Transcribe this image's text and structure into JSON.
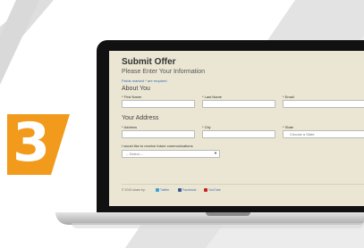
{
  "step": {
    "number": "3",
    "color": "#f29a1c"
  },
  "form": {
    "title": "Submit Offer",
    "subtitle": "Please Enter Your Information",
    "required_note": "Fields marked * are required",
    "sections": {
      "about": "About You",
      "address": "Your Address"
    },
    "fields": {
      "first_name": {
        "label": "* First Name",
        "value": ""
      },
      "last_name": {
        "label": "* Last Name",
        "value": ""
      },
      "email": {
        "label": "* Email",
        "value": ""
      },
      "address": {
        "label": "* Address",
        "value": ""
      },
      "city": {
        "label": "* City",
        "value": ""
      },
      "state": {
        "label": "* State",
        "placeholder": "Choose a State"
      }
    },
    "communications": {
      "label": "I would like to receive future communications",
      "selected": "-- Select --"
    },
    "footer": {
      "share_label": "© 2013 share by:",
      "links": [
        "Twitter",
        "Facebook",
        "YouTube"
      ]
    }
  },
  "colors": {
    "screen": "#eae6d3",
    "link": "#3b6bb3"
  }
}
